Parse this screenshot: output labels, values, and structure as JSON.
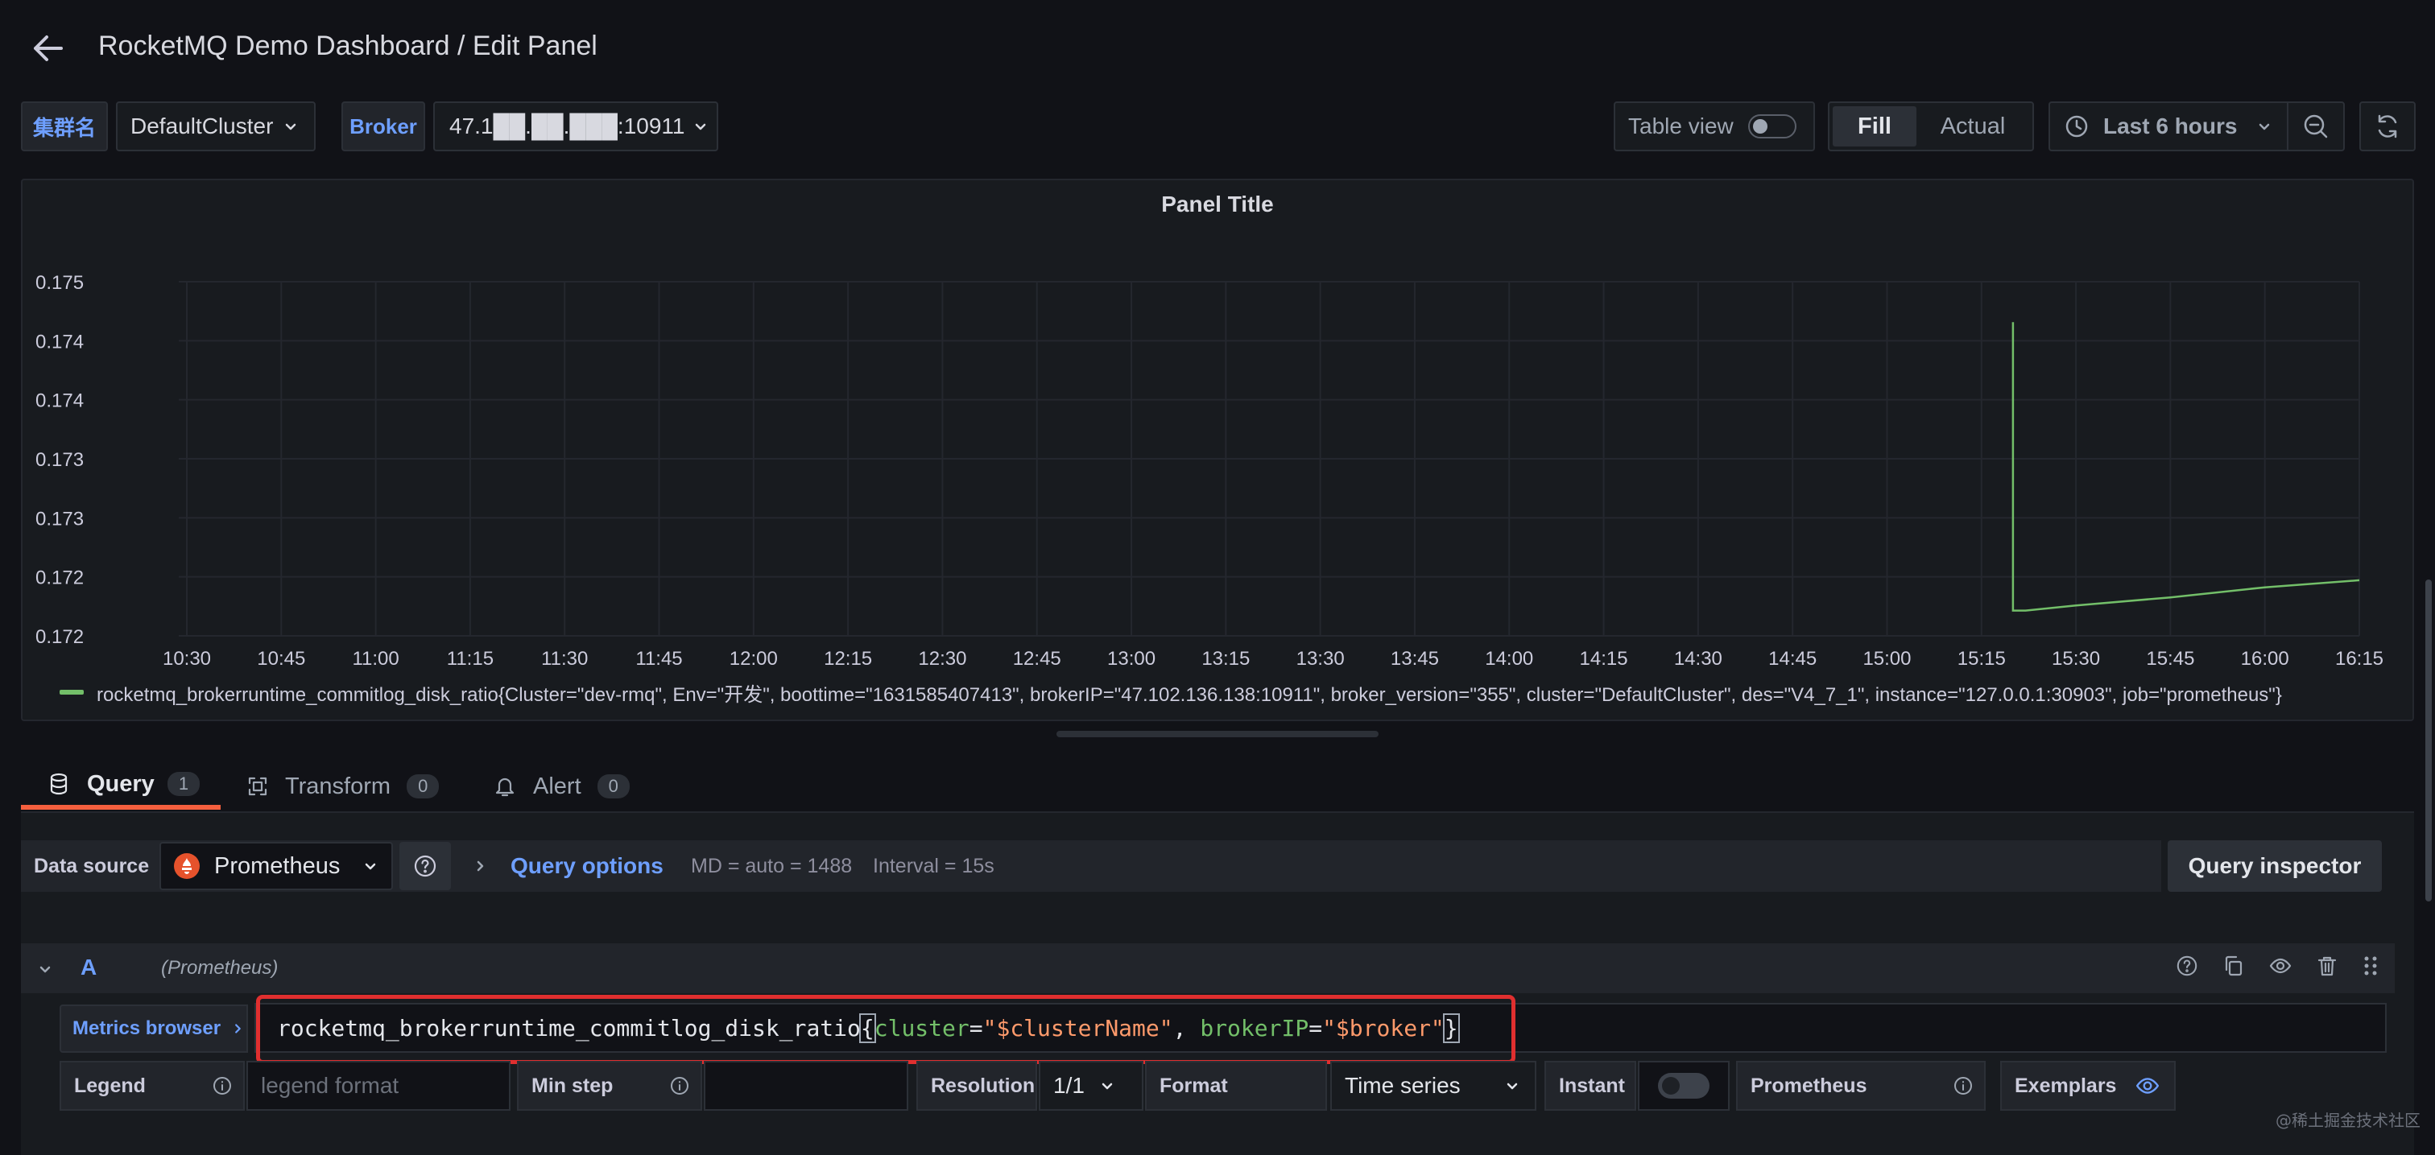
{
  "header": {
    "title": "RocketMQ Demo Dashboard / Edit Panel"
  },
  "variables": [
    {
      "label": "集群名",
      "value": "DefaultCluster"
    },
    {
      "label": "Broker",
      "value": "47.1██.██.███:10911"
    }
  ],
  "toolbar": {
    "table_view_label": "Table view",
    "fill_label": "Fill",
    "actual_label": "Actual",
    "time_range": "Last 6 hours"
  },
  "panel": {
    "title": "Panel Title",
    "legend": "rocketmq_brokerruntime_commitlog_disk_ratio{Cluster=\"dev-rmq\", Env=\"开发\", boottime=\"1631585407413\", brokerIP=\"47.102.136.138:10911\", broker_version=\"355\", cluster=\"DefaultCluster\", des=\"V4_7_1\", instance=\"127.0.0.1:30903\", job=\"prometheus\"}"
  },
  "chart_data": {
    "type": "line",
    "title": "Panel Title",
    "x_ticks": [
      "10:30",
      "10:45",
      "11:00",
      "11:15",
      "11:30",
      "11:45",
      "12:00",
      "12:15",
      "12:30",
      "12:45",
      "13:00",
      "13:15",
      "13:30",
      "13:45",
      "14:00",
      "14:15",
      "14:30",
      "14:45",
      "15:00",
      "15:15",
      "15:30",
      "15:45",
      "16:00",
      "16:15"
    ],
    "y_ticks": [
      "0.175",
      "0.174",
      "0.174",
      "0.173",
      "0.173",
      "0.172",
      "0.172"
    ],
    "ylim": [
      0.1715,
      0.175
    ],
    "series": [
      {
        "name": "rocketmq_brokerruntime_commitlog_disk_ratio",
        "color": "#73bf69",
        "points": [
          [
            "15:20",
            0.1746
          ],
          [
            "15:20",
            0.17175
          ],
          [
            "15:22",
            0.17175
          ],
          [
            "15:30",
            0.1718
          ],
          [
            "15:45",
            0.17188
          ],
          [
            "16:00",
            0.17198
          ],
          [
            "16:15",
            0.17205
          ]
        ]
      }
    ],
    "grid": true,
    "legend_position": "bottom"
  },
  "tabs": [
    {
      "label": "Query",
      "count": "1",
      "active": true
    },
    {
      "label": "Transform",
      "count": "0",
      "active": false
    },
    {
      "label": "Alert",
      "count": "0",
      "active": false
    }
  ],
  "datasource": {
    "label": "Data source",
    "name": "Prometheus",
    "query_options_label": "Query options",
    "md_info": "MD = auto = 1488",
    "interval_info": "Interval = 15s",
    "inspector_label": "Query inspector"
  },
  "query": {
    "ref_id": "A",
    "ds_hint": "(Prometheus)",
    "metrics_browser_label": "Metrics browser",
    "metric": "rocketmq_brokerruntime_commitlog_disk_ratio",
    "brace_open": "{",
    "label1_key": "cluster",
    "eq": "=",
    "label1_val": "\"$clusterName\"",
    "comma": ", ",
    "label2_key": "brokerIP",
    "label2_val": "\"$broker\"",
    "brace_close": "}"
  },
  "options_row": {
    "legend_label": "Legend",
    "legend_placeholder": "legend format",
    "min_step_label": "Min step",
    "resolution_label": "Resolution",
    "resolution_value": "1/1",
    "format_label": "Format",
    "format_value": "Time series",
    "instant_label": "Instant",
    "prometheus_label": "Prometheus",
    "exemplars_label": "Exemplars"
  },
  "watermark": "@稀土掘金技术社区",
  "colors": {
    "accent_blue": "#6e9fff",
    "tab_underline": "#f55f3e",
    "series_green": "#73bf69",
    "highlight_red": "#e02f2f"
  }
}
